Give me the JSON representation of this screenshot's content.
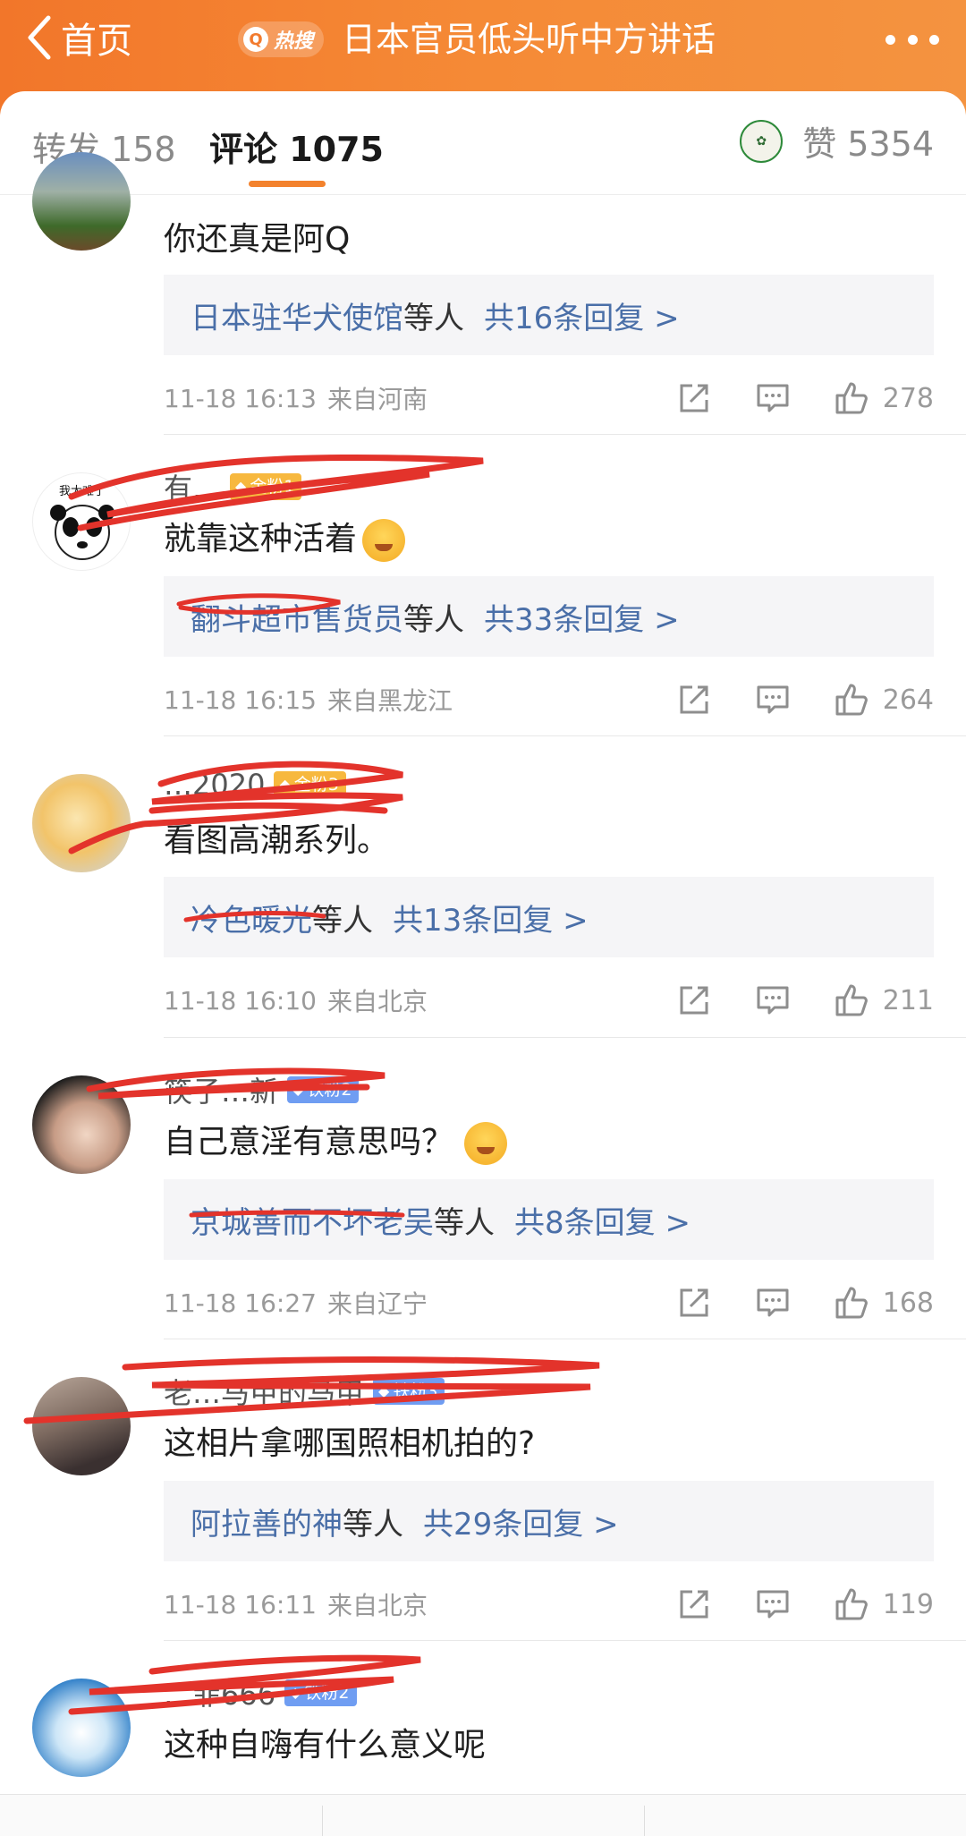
{
  "topbar": {
    "back_label": "首页",
    "hot_badge": "热搜",
    "topic_title": "日本官员低头听中方讲话"
  },
  "tabs": {
    "repost": "转发 158",
    "comments": "评论 1075",
    "likes": "赞 5354"
  },
  "comments": [
    {
      "username": "",
      "badge": "",
      "text": "你还真是阿Q",
      "reply_user": "日本驻华犬使馆",
      "reply_etc": "等人",
      "reply_count": "共16条回复 >",
      "time": "11-18 16:13",
      "location": "来自河南",
      "likes": "278"
    },
    {
      "username": "有…",
      "badge": "金粉1",
      "text": "就靠这种活着",
      "reply_user": "翻斗超市售货员",
      "reply_etc": "等人",
      "reply_count": "共33条回复 >",
      "time": "11-18 16:15",
      "location": "来自黑龙江",
      "likes": "264"
    },
    {
      "username": "…2020",
      "badge": "金粉3",
      "text": "看图高潮系列。",
      "reply_user": "冷色暖光",
      "reply_etc": "等人",
      "reply_count": "共13条回复 >",
      "time": "11-18 16:10",
      "location": "来自北京",
      "likes": "211"
    },
    {
      "username": "筷子…新",
      "badge": "铁粉2",
      "text": "自己意淫有意思吗？",
      "reply_user": "京城善而不坏老吴",
      "reply_etc": "等人",
      "reply_count": "共8条回复 >",
      "time": "11-18 16:27",
      "location": "来自辽宁",
      "likes": "168"
    },
    {
      "username": "老…马甲的马甲",
      "badge": "铁粉3",
      "text": "这相片拿哪国照相机拍的?",
      "reply_user": "阿拉善的神",
      "reply_etc": "等人",
      "reply_count": "共29条回复 >",
      "time": "11-18 16:11",
      "location": "来自北京",
      "likes": "119"
    },
    {
      "username": "…菲666",
      "badge": "铁粉2",
      "text": "这种自嗨有什么意义呢"
    }
  ],
  "colors": {
    "topbar": "#f58a36",
    "accent": "#f3822d",
    "link": "#4a6fa8",
    "gold_badge": "#f7b83e",
    "iron_badge": "#6f9df2",
    "redaction": "#e3332b"
  }
}
